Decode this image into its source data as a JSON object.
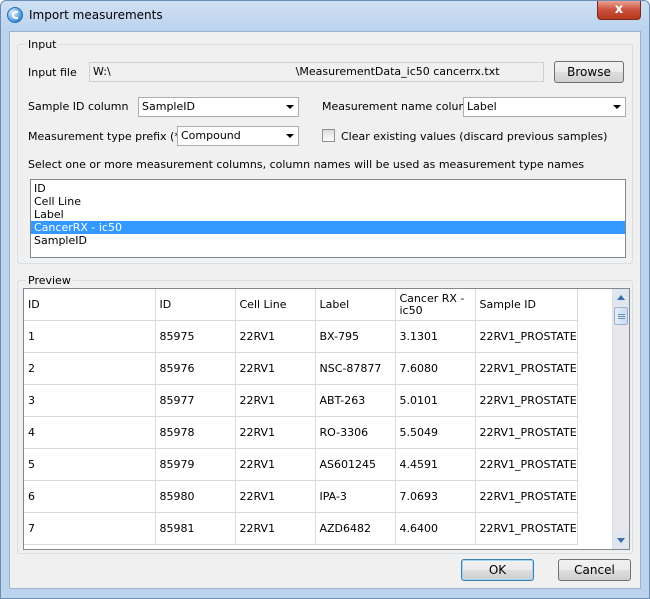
{
  "window": {
    "title": "Import measurements",
    "close_glyph": "x"
  },
  "input_group": {
    "label": "Input",
    "input_file_label": "Input file",
    "input_file_value_prefix": "W:\\",
    "input_file_value_suffix": "\\MeasurementData_ic50 cancerrx.txt",
    "browse_label": "Browse",
    "sample_id_label": "Sample ID column",
    "sample_id_value": "SampleID",
    "measurement_name_label": "Measurement name column",
    "measurement_name_value": "Label",
    "type_prefix_label": "Measurement type prefix (*)",
    "type_prefix_value": "Compound",
    "clear_existing_label": "Clear existing values (discard previous samples)",
    "clear_existing_checked": false,
    "select_instruction": "Select one or more measurement columns, column names will be used as measurement type names",
    "columns_list": [
      "ID",
      "Cell Line",
      "Label",
      "CancerRX - ic50",
      "SampleID"
    ],
    "columns_selected_index": 3
  },
  "preview": {
    "label": "Preview",
    "headers": [
      "ID",
      "ID",
      "Cell  Line",
      "Label",
      "Cancer RX - ic50",
      "Sample ID"
    ],
    "rows": [
      [
        "1",
        "85975",
        "22RV1",
        "BX-795",
        "3.1301",
        "22RV1_PROSTATE"
      ],
      [
        "2",
        "85976",
        "22RV1",
        "NSC-87877",
        "7.6080",
        "22RV1_PROSTATE"
      ],
      [
        "3",
        "85977",
        "22RV1",
        "ABT-263",
        "5.0101",
        "22RV1_PROSTATE"
      ],
      [
        "4",
        "85978",
        "22RV1",
        "RO-3306",
        "5.5049",
        "22RV1_PROSTATE"
      ],
      [
        "5",
        "85979",
        "22RV1",
        "AS601245",
        "4.4591",
        "22RV1_PROSTATE"
      ],
      [
        "6",
        "85980",
        "22RV1",
        "IPA-3",
        "7.0693",
        "22RV1_PROSTATE"
      ],
      [
        "7",
        "85981",
        "22RV1",
        "AZD6482",
        "4.6400",
        "22RV1_PROSTATE"
      ]
    ]
  },
  "footer": {
    "ok_label": "OK",
    "cancel_label": "Cancel"
  },
  "colors": {
    "selection": "#3399ff",
    "titlebar": "#bcd3ee",
    "close": "#c9503a"
  }
}
